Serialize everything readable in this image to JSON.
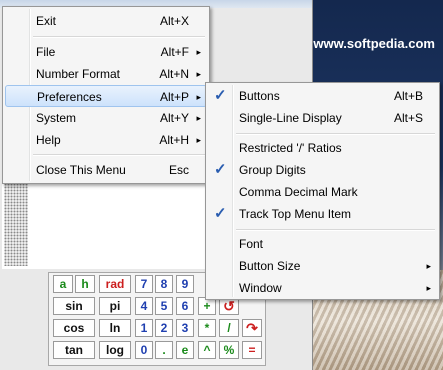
{
  "desktop": {
    "brand": "www.softpedia.com"
  },
  "main_menu": {
    "items": [
      {
        "label": "Exit",
        "accel": "Alt+X",
        "submenu": false
      },
      {
        "label": "File",
        "accel": "Alt+F",
        "submenu": true
      },
      {
        "label": "Number Format",
        "accel": "Alt+N",
        "submenu": true
      },
      {
        "label": "Preferences",
        "accel": "Alt+P",
        "submenu": true,
        "highlighted": true
      },
      {
        "label": "System",
        "accel": "Alt+Y",
        "submenu": true
      },
      {
        "label": "Help",
        "accel": "Alt+H",
        "submenu": true
      },
      {
        "label": "Close This Menu",
        "accel": "Esc",
        "submenu": false
      }
    ]
  },
  "preferences_menu": {
    "items": [
      {
        "label": "Buttons",
        "accel": "Alt+B",
        "checked": true
      },
      {
        "label": "Single-Line Display",
        "accel": "Alt+S",
        "checked": false
      },
      {
        "label": "Restricted '/' Ratios",
        "checked": false
      },
      {
        "label": "Group Digits",
        "checked": true
      },
      {
        "label": "Comma Decimal Mark",
        "checked": false
      },
      {
        "label": "Track Top Menu Item",
        "checked": true
      },
      {
        "label": "Font",
        "checked": false
      },
      {
        "label": "Button Size",
        "submenu": true
      },
      {
        "label": "Window",
        "submenu": true
      }
    ],
    "check_glyph": "✓",
    "arrow_glyph": "▸"
  },
  "keypad": {
    "row1": [
      "a",
      "h",
      "rad",
      "7",
      "8",
      "9"
    ],
    "row2": [
      "sin",
      "pi",
      "4",
      "5",
      "6",
      "+"
    ],
    "row3": [
      "cos",
      "ln",
      "1",
      "2",
      "3",
      "*",
      "/"
    ],
    "row4": [
      "tan",
      "log",
      "0",
      ".",
      "e",
      "^",
      "%",
      "="
    ],
    "icons": {
      "undo": "undo-icon",
      "redo": "redo-icon"
    }
  }
}
